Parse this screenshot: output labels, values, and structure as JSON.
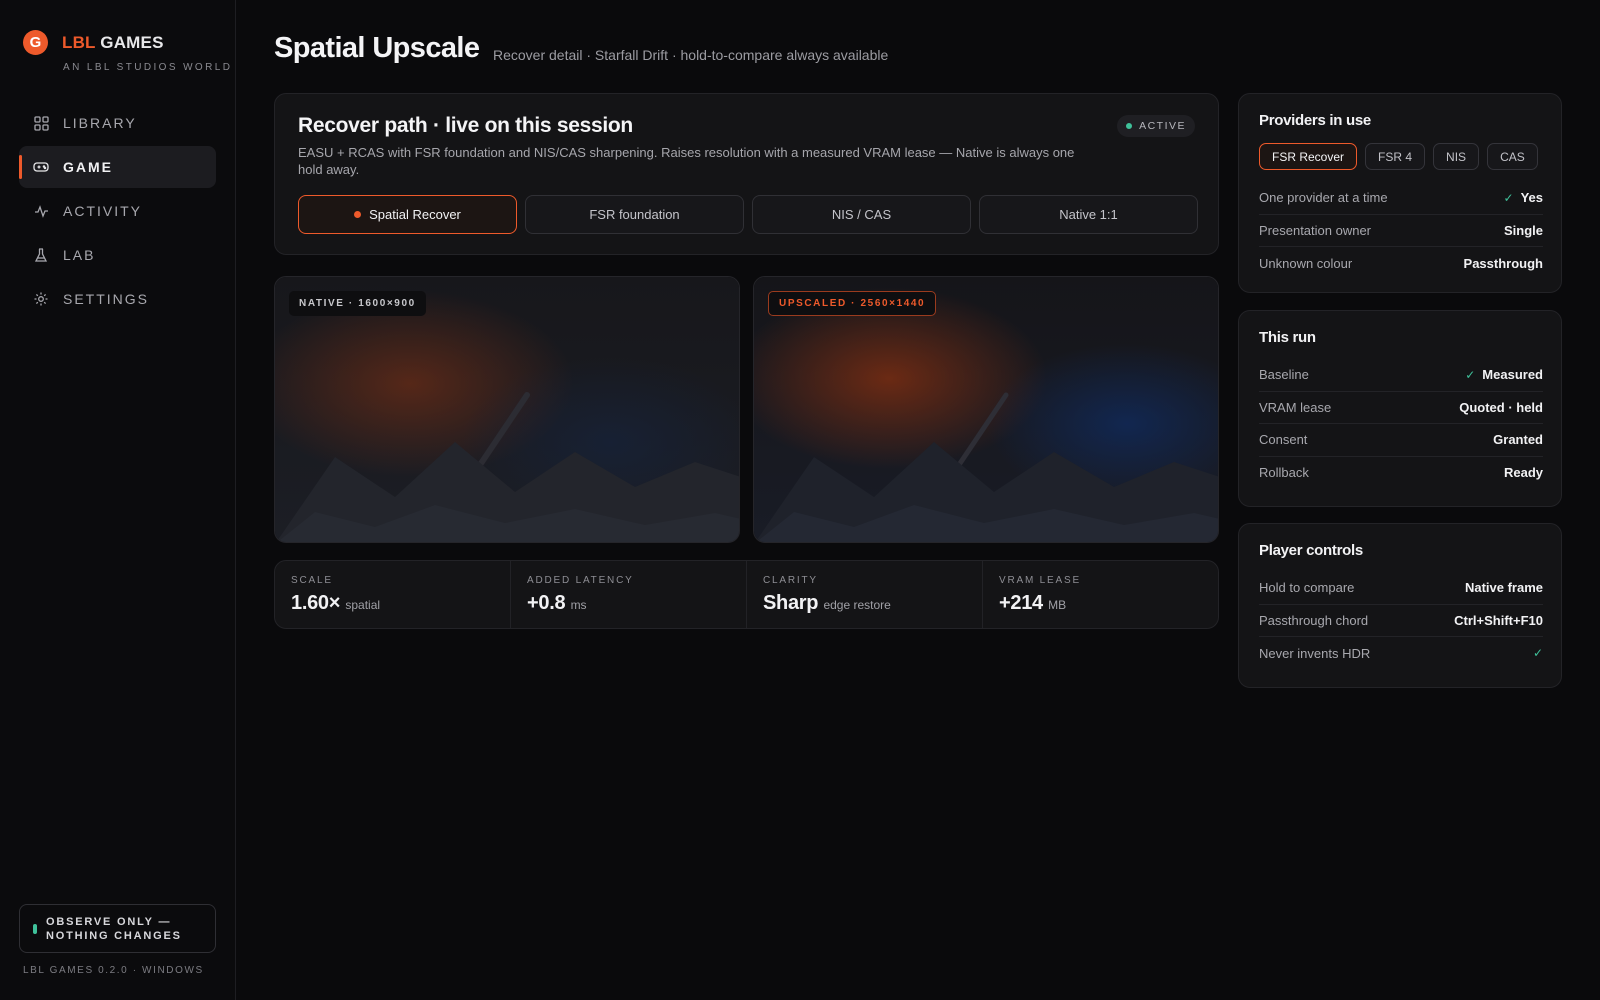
{
  "brand": {
    "logo_letter": "G",
    "name_accent": "LBL",
    "name_rest": " GAMES",
    "tagline": "AN LBL STUDIOS WORLD"
  },
  "nav": {
    "items": [
      {
        "label": "LIBRARY",
        "icon": "grid-icon",
        "active": false
      },
      {
        "label": "GAME",
        "icon": "gamepad-icon",
        "active": true
      },
      {
        "label": "ACTIVITY",
        "icon": "pulse-icon",
        "active": false
      },
      {
        "label": "LAB",
        "icon": "flask-icon",
        "active": false
      },
      {
        "label": "SETTINGS",
        "icon": "gear-icon",
        "active": false
      }
    ]
  },
  "footer": {
    "observe": "OBSERVE ONLY — NOTHING CHANGES",
    "version": "LBL GAMES 0.2.0 · WINDOWS"
  },
  "header": {
    "title": "Spatial Upscale",
    "subtitle": "Recover detail · Starfall Drift · hold-to-compare always available"
  },
  "recover": {
    "title": "Recover path · live on this session",
    "description": "EASU + RCAS with FSR foundation and NIS/CAS sharpening. Raises resolution with a measured VRAM lease — Native is always one hold away.",
    "badge": "ACTIVE",
    "modes": [
      {
        "label": "Spatial Recover",
        "selected": true
      },
      {
        "label": "FSR foundation",
        "selected": false
      },
      {
        "label": "NIS / CAS",
        "selected": false
      },
      {
        "label": "Native 1:1",
        "selected": false
      }
    ]
  },
  "frames": {
    "native_label": "NATIVE · 1600×900",
    "upscaled_label": "UPSCALED · 2560×1440"
  },
  "stats": [
    {
      "label": "SCALE",
      "value": "1.60×",
      "unit": "spatial"
    },
    {
      "label": "ADDED LATENCY",
      "value": "+0.8",
      "unit": "ms"
    },
    {
      "label": "CLARITY",
      "value": "Sharp",
      "unit": "edge restore"
    },
    {
      "label": "VRAM LEASE",
      "value": "+214",
      "unit": "MB"
    }
  ],
  "providers": {
    "title": "Providers in use",
    "chips": [
      {
        "label": "FSR Recover",
        "selected": true
      },
      {
        "label": "FSR 4",
        "selected": false
      },
      {
        "label": "NIS",
        "selected": false
      },
      {
        "label": "CAS",
        "selected": false
      }
    ],
    "rows": [
      {
        "label": "One provider at a time",
        "value": "Yes",
        "check": true
      },
      {
        "label": "Presentation owner",
        "value": "Single",
        "check": false
      },
      {
        "label": "Unknown colour",
        "value": "Passthrough",
        "check": false
      }
    ]
  },
  "run": {
    "title": "This run",
    "rows": [
      {
        "label": "Baseline",
        "value": "Measured",
        "check": true
      },
      {
        "label": "VRAM lease",
        "value": "Quoted · held",
        "check": false
      },
      {
        "label": "Consent",
        "value": "Granted",
        "check": false
      },
      {
        "label": "Rollback",
        "value": "Ready",
        "check": false
      }
    ]
  },
  "controls": {
    "title": "Player controls",
    "rows": [
      {
        "label": "Hold to compare",
        "value": "Native frame",
        "check": false
      },
      {
        "label": "Passthrough chord",
        "value": "Ctrl+Shift+F10",
        "check": false
      },
      {
        "label": "Never invents HDR",
        "value": "",
        "check": true
      }
    ]
  },
  "colors": {
    "accent": "#ee5a2b",
    "success": "#3fc19a",
    "background": "#0a0a0c",
    "card": "#141416"
  }
}
